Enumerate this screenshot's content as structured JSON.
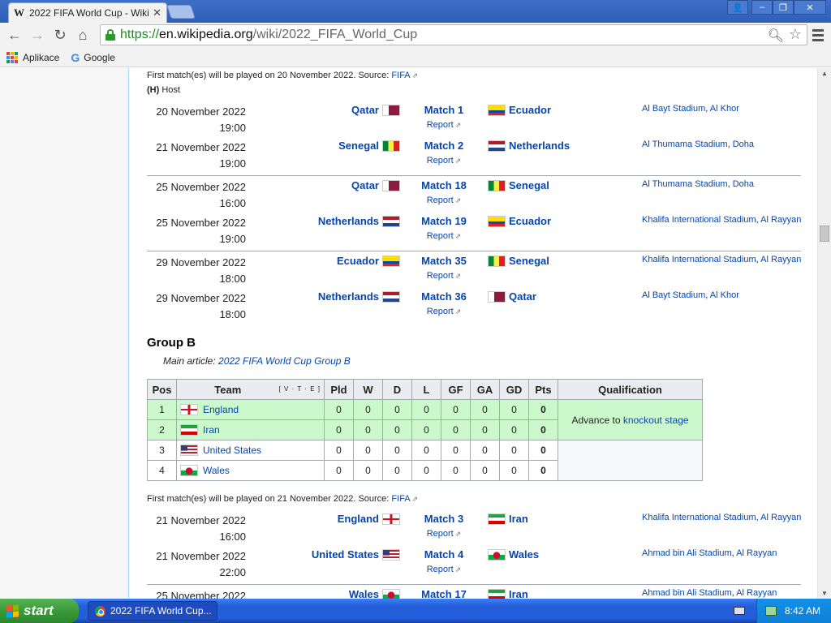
{
  "browser": {
    "tab_title": "2022 FIFA World Cup - Wikip",
    "tab_favicon": "W",
    "url_scheme": "https://",
    "url_host": "en.wikipedia.org",
    "url_path": "/wiki/2022_FIFA_World_Cup",
    "bookmarks": [
      {
        "label": "Aplikace"
      },
      {
        "label": "Google"
      }
    ]
  },
  "group_a": {
    "source_prefix": "First match(es) will be played on 20 November 2022. Source: ",
    "source_link": "FIFA",
    "host_key": "(H)",
    "host_label": " Host",
    "matches": [
      {
        "date": "20 November 2022",
        "time": "19:00",
        "home": "Qatar",
        "home_flag": "qatar",
        "match": "Match 1",
        "report": "Report",
        "away": "Ecuador",
        "away_flag": "ecuador",
        "stadium": "Al Bayt Stadium",
        "city": "Al Khor"
      },
      {
        "date": "21 November 2022",
        "time": "19:00",
        "home": "Senegal",
        "home_flag": "senegal",
        "match": "Match 2",
        "report": "Report",
        "away": "Netherlands",
        "away_flag": "netherlands",
        "stadium": "Al Thumama Stadium",
        "city": "Doha"
      },
      {
        "date": "25 November 2022",
        "time": "16:00",
        "home": "Qatar",
        "home_flag": "qatar",
        "match": "Match 18",
        "report": "Report",
        "away": "Senegal",
        "away_flag": "senegal",
        "stadium": "Al Thumama Stadium",
        "city": "Doha"
      },
      {
        "date": "25 November 2022",
        "time": "19:00",
        "home": "Netherlands",
        "home_flag": "netherlands",
        "match": "Match 19",
        "report": "Report",
        "away": "Ecuador",
        "away_flag": "ecuador",
        "stadium": "Khalifa International Stadium",
        "city": "Al Rayyan"
      },
      {
        "date": "29 November 2022",
        "time": "18:00",
        "home": "Ecuador",
        "home_flag": "ecuador",
        "match": "Match 35",
        "report": "Report",
        "away": "Senegal",
        "away_flag": "senegal",
        "stadium": "Khalifa International Stadium",
        "city": "Al Rayyan"
      },
      {
        "date": "29 November 2022",
        "time": "18:00",
        "home": "Netherlands",
        "home_flag": "netherlands",
        "match": "Match 36",
        "report": "Report",
        "away": "Qatar",
        "away_flag": "qatar",
        "stadium": "Al Bayt Stadium",
        "city": "Al Khor"
      }
    ]
  },
  "group_b": {
    "heading": "Group B",
    "main_article_prefix": "Main article: ",
    "main_article_link": "2022 FIFA World Cup Group B",
    "table": {
      "headers": [
        "Pos",
        "Team",
        "Pld",
        "W",
        "D",
        "L",
        "GF",
        "GA",
        "GD",
        "Pts",
        "Qualification"
      ],
      "vte": "[ V · T · E ]",
      "rows": [
        {
          "pos": "1",
          "team": "England",
          "flag": "england",
          "pld": "0",
          "w": "0",
          "d": "0",
          "l": "0",
          "gf": "0",
          "ga": "0",
          "gd": "0",
          "pts": "0"
        },
        {
          "pos": "2",
          "team": "Iran",
          "flag": "iran",
          "pld": "0",
          "w": "0",
          "d": "0",
          "l": "0",
          "gf": "0",
          "ga": "0",
          "gd": "0",
          "pts": "0"
        },
        {
          "pos": "3",
          "team": "United States",
          "flag": "usa",
          "pld": "0",
          "w": "0",
          "d": "0",
          "l": "0",
          "gf": "0",
          "ga": "0",
          "gd": "0",
          "pts": "0"
        },
        {
          "pos": "4",
          "team": "Wales",
          "flag": "wales",
          "pld": "0",
          "w": "0",
          "d": "0",
          "l": "0",
          "gf": "0",
          "ga": "0",
          "gd": "0",
          "pts": "0"
        }
      ],
      "qualification_prefix": "Advance to ",
      "qualification_link": "knockout stage"
    },
    "source_prefix": "First match(es) will be played on 21 November 2022. Source: ",
    "source_link": "FIFA",
    "matches": [
      {
        "date": "21 November 2022",
        "time": "16:00",
        "home": "England",
        "home_flag": "england",
        "match": "Match 3",
        "report": "Report",
        "away": "Iran",
        "away_flag": "iran",
        "stadium": "Khalifa International Stadium",
        "city": "Al Rayyan"
      },
      {
        "date": "21 November 2022",
        "time": "22:00",
        "home": "United States",
        "home_flag": "usa",
        "match": "Match 4",
        "report": "Report",
        "away": "Wales",
        "away_flag": "wales",
        "stadium": "Ahmad bin Ali Stadium",
        "city": "Al Rayyan"
      },
      {
        "date": "25 November 2022",
        "time": "",
        "home": "Wales",
        "home_flag": "wales",
        "match": "Match 17",
        "report": "",
        "away": "Iran",
        "away_flag": "iran",
        "stadium": "Ahmad bin Ali Stadium",
        "city": "Al Rayyan"
      }
    ]
  },
  "taskbar": {
    "start_label": "start",
    "task_label": "2022 FIFA World Cup...",
    "clock": "8:42 AM"
  },
  "colors": {
    "link": "#0645ad",
    "qualify": "#ccf9cc",
    "header_bg": "#eaecf0"
  }
}
